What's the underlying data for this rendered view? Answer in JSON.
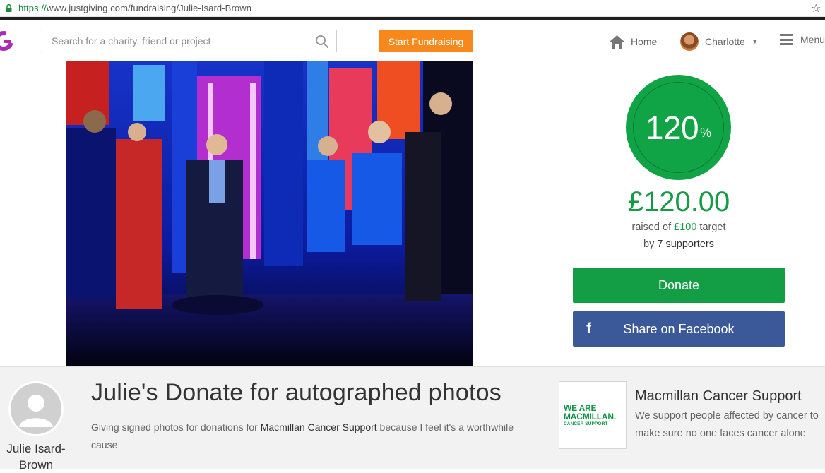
{
  "browser": {
    "url_protocol": "https://",
    "url_rest": "www.justgiving.com/fundraising/Julie-Isard-Brown"
  },
  "header": {
    "search_placeholder": "Search for a charity, friend or project",
    "start_label": "Start Fundraising",
    "home_label": "Home",
    "user_name": "Charlotte",
    "menu_label": "Menu",
    "user_caret": "▼"
  },
  "progress": {
    "percent_number": "120",
    "percent_sign": "%",
    "percent_fraction": 1.2,
    "raised": "£120.00",
    "target_prefix": "raised of ",
    "target_amount": "£100",
    "target_suffix": " target",
    "supporters_prefix": "by ",
    "supporters_count": "7 supporters"
  },
  "actions": {
    "donate_label": "Donate",
    "facebook_label": "Share on Facebook",
    "facebook_icon": "f"
  },
  "page": {
    "owner_name": "Julie Isard-Brown",
    "title": "Julie's Donate for autographed photos",
    "desc_prefix": "Giving signed photos for donations for ",
    "desc_charity": "Macmillan Cancer Support",
    "desc_suffix": " because I feel it's a worthwhile cause"
  },
  "charity": {
    "name": "Macmillan Cancer Support",
    "description": "We support people affected by cancer to make sure no one faces cancer alone",
    "logo_line1": "WE ARE",
    "logo_line2": "MACMILLAN.",
    "logo_line3": "CANCER SUPPORT"
  },
  "colors": {
    "brand_green": "#139d45",
    "facebook_blue": "#3b5998",
    "start_orange": "#f7891c",
    "logo_purple": "#ad29b6"
  }
}
